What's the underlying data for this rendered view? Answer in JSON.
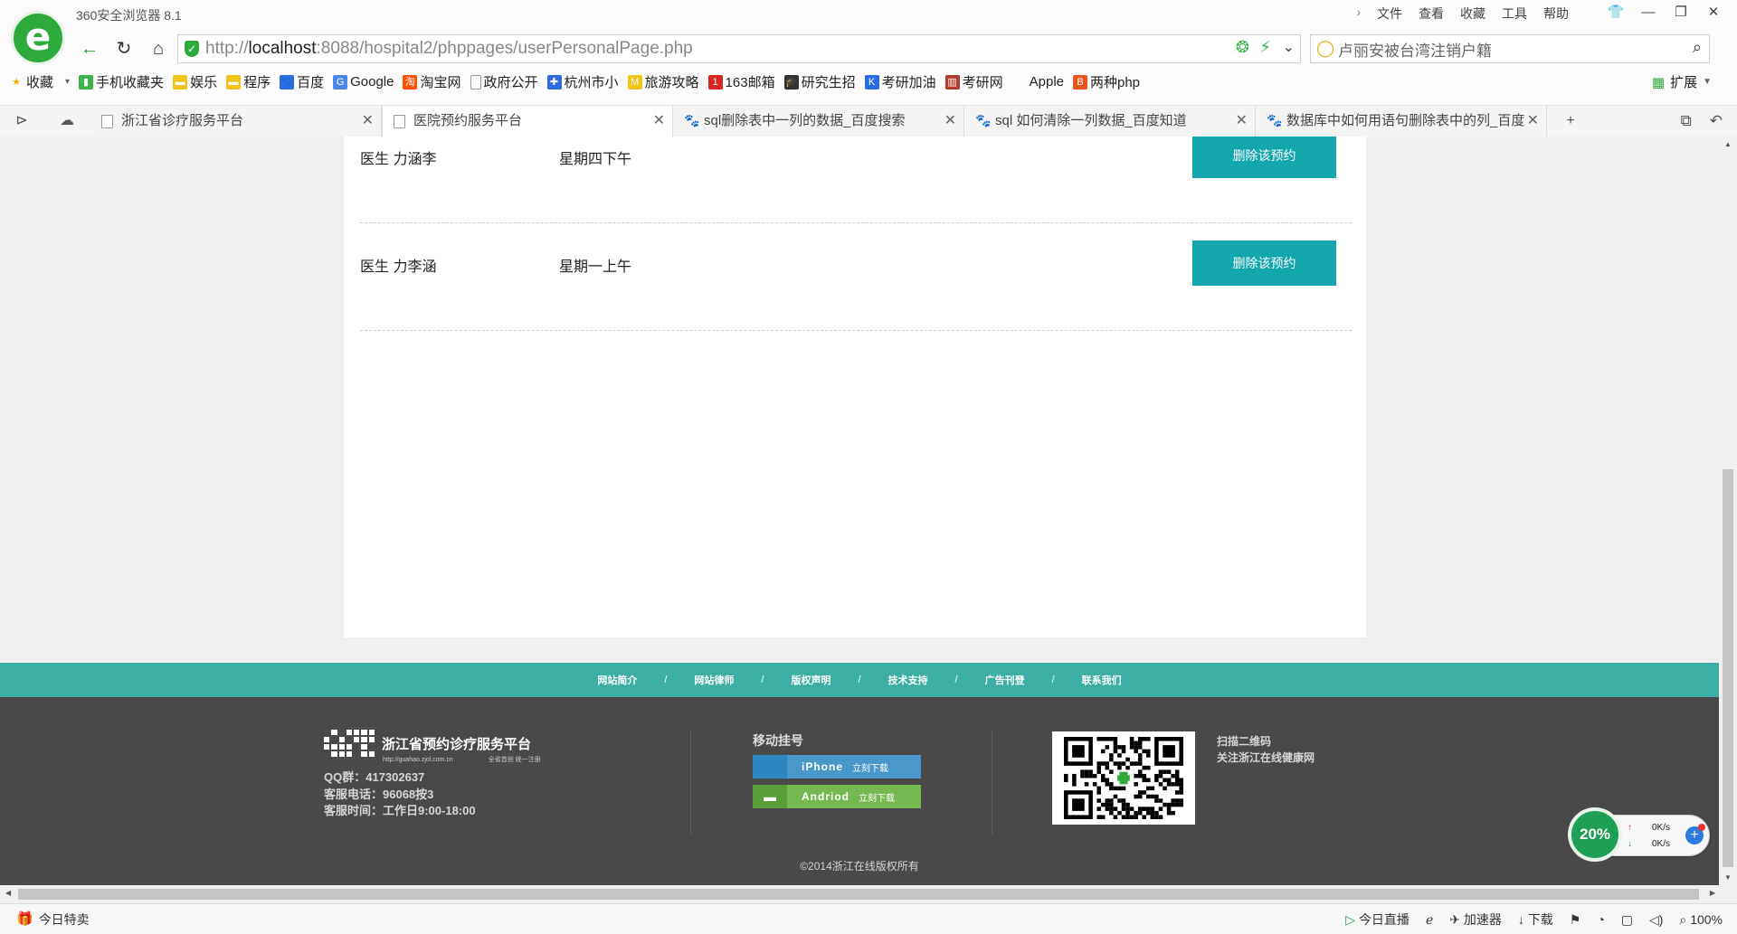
{
  "browser": {
    "title": "360安全浏览器 8.1",
    "menu": [
      "文件",
      "查看",
      "收藏",
      "工具",
      "帮助"
    ],
    "address_host_prefix": "http://",
    "address_host": "localhost",
    "address_rest": ":8088/hospital2/phppages/userPersonalPage.php",
    "search_value": "卢丽安被台湾注销户籍",
    "bookmarks": [
      {
        "label": "收藏",
        "icon": "star-icon",
        "color": "#f2b400"
      },
      {
        "label": "手机收藏夹",
        "icon": "phone-icon",
        "color": "#3bb54a"
      },
      {
        "label": "娱乐",
        "icon": "folder-icon",
        "color": "#f0c419"
      },
      {
        "label": "程序",
        "icon": "folder-icon",
        "color": "#f0c419"
      },
      {
        "label": "百度",
        "icon": "baidu-paw-icon",
        "color": "#2d6ce0"
      },
      {
        "label": "Google",
        "icon": "google-icon",
        "color": "#4a86e8"
      },
      {
        "label": "淘宝网",
        "icon": "taobao-icon",
        "color": "#ff5000"
      },
      {
        "label": "政府公开",
        "icon": "page-icon",
        "color": "#999999"
      },
      {
        "label": "杭州市小",
        "icon": "cross-icon",
        "color": "#2d6ce0"
      },
      {
        "label": "旅游攻略",
        "icon": "mail-icon",
        "color": "#f0c419"
      },
      {
        "label": "163邮箱",
        "icon": "163-icon",
        "color": "#d8261f"
      },
      {
        "label": "研究生招",
        "icon": "cap-icon",
        "color": "#333333"
      },
      {
        "label": "考研加油",
        "icon": "k-icon",
        "color": "#2d6ce0"
      },
      {
        "label": "考研网",
        "icon": "books-icon",
        "color": "#b23a2e"
      },
      {
        "label": "Apple",
        "icon": "apple-icon",
        "color": "#777777"
      },
      {
        "label": "两种php",
        "icon": "b-icon",
        "color": "#e9531c"
      }
    ],
    "extensions_label": "扩展",
    "tabs": [
      {
        "label": "浙江省诊疗服务平台",
        "icon": "page-icon",
        "active": false
      },
      {
        "label": "医院预约服务平台",
        "icon": "page-icon",
        "active": true
      },
      {
        "label": "sql删除表中一列的数据_百度搜索",
        "icon": "baidu-paw-icon",
        "active": false
      },
      {
        "label": "sql 如何清除一列数据_百度知道",
        "icon": "baidu-paw-icon",
        "active": false
      },
      {
        "label": "数据库中如何用语句删除表中的列_百度",
        "icon": "baidu-paw-icon",
        "active": false
      }
    ]
  },
  "appointments": [
    {
      "doctor": "医生  力涵李",
      "time": "星期四下午",
      "delete_label": "删除该预约"
    },
    {
      "doctor": "医生  力李涵",
      "time": "星期一上午",
      "delete_label": "删除该预约"
    }
  ],
  "footer": {
    "links": [
      "网站简介",
      "网站律师",
      "版权声明",
      "技术支持",
      "广告刊登",
      "联系我们"
    ],
    "link_separator": "/",
    "brand": "浙江省预约诊疗服务平台",
    "brand_url": "http://guahao.zjol.com.cn",
    "brand_slogan": "全省首创  统一注册",
    "qq": "QQ群：417302637",
    "phone": "客服电话：96068按3",
    "hours": "客服时间：工作日9:00-18:00",
    "mobile_title": "移动挂号",
    "downloads": [
      {
        "name": "iPhone",
        "action": "立刻下载",
        "color": "#4a97c9",
        "icon_color": "#2e86c1"
      },
      {
        "name": "Andriod",
        "action": "立刻下载",
        "color": "#76b852",
        "icon_color": "#5a9e3a"
      }
    ],
    "scan_line1": "扫描二维码",
    "scan_line2": "关注浙江在线健康网",
    "copyright": "©2014浙江在线版权所有"
  },
  "speed_widget": {
    "percent": "20%",
    "up": "0K/s",
    "down": "0K/s"
  },
  "status_bar": {
    "left": "今日特卖",
    "items": [
      "今日直播",
      "加速器",
      "下载",
      "100%"
    ]
  }
}
